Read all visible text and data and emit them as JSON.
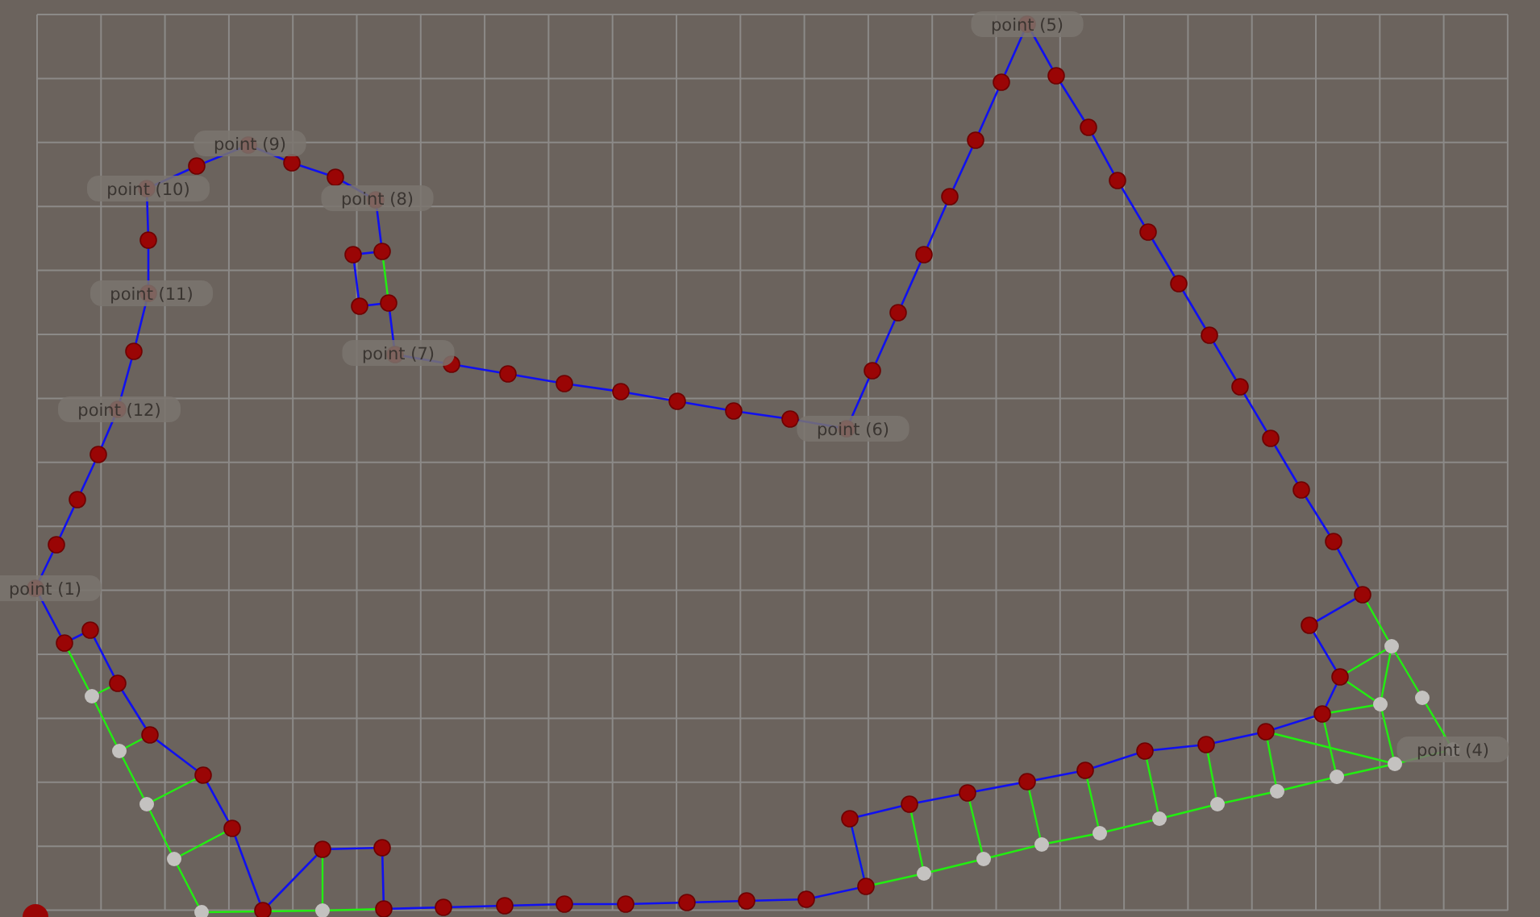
{
  "labels": [
    {
      "text": "point (5)"
    },
    {
      "text": "point (9)"
    },
    {
      "text": "point (10)"
    },
    {
      "text": "point (8)"
    },
    {
      "text": "point (11)"
    },
    {
      "text": "point (7)"
    },
    {
      "text": "point (12)"
    },
    {
      "text": "point (6)"
    },
    {
      "text": "point (1)"
    },
    {
      "text": "point (4)"
    }
  ]
}
